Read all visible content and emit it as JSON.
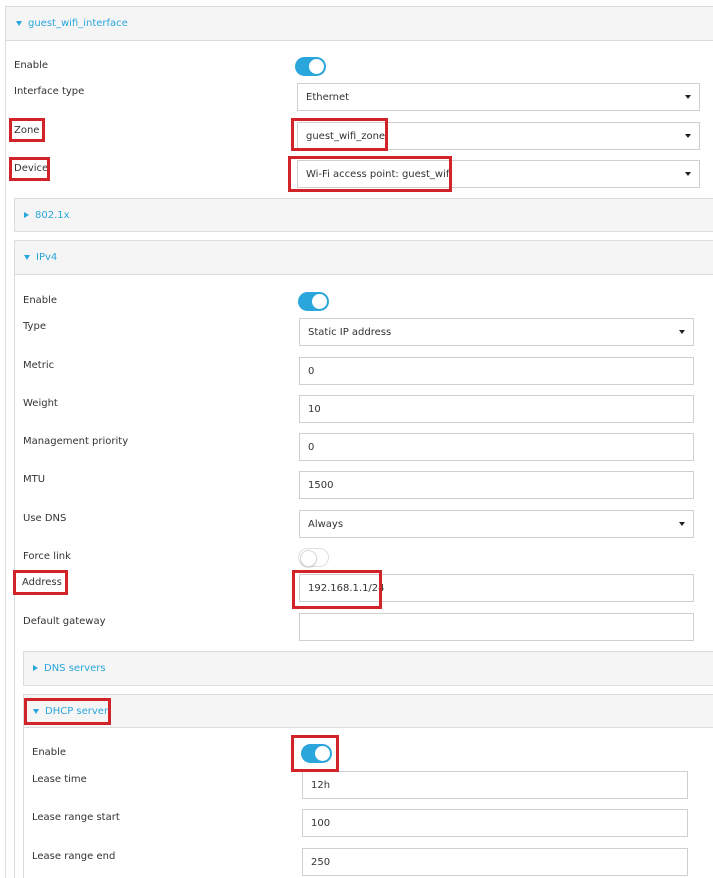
{
  "interface": {
    "title": "guest_wifi_interface",
    "enable_label": "Enable",
    "enabled": true,
    "interface_type_label": "Interface type",
    "interface_type_value": "Ethernet",
    "zone_label": "Zone",
    "zone_value": "guest_wifi_zone",
    "device_label": "Device",
    "device_value": "Wi-Fi access point: guest_wifi"
  },
  "dot1x": {
    "title": "802.1x"
  },
  "ipv4": {
    "title": "IPv4",
    "enable_label": "Enable",
    "enabled": true,
    "type_label": "Type",
    "type_value": "Static IP address",
    "metric_label": "Metric",
    "metric_value": "0",
    "weight_label": "Weight",
    "weight_value": "10",
    "mgmt_priority_label": "Management priority",
    "mgmt_priority_value": "0",
    "mtu_label": "MTU",
    "mtu_value": "1500",
    "use_dns_label": "Use DNS",
    "use_dns_value": "Always",
    "force_link_label": "Force link",
    "force_link": false,
    "address_label": "Address",
    "address_value": "192.168.1.1/24",
    "gateway_label": "Default gateway",
    "gateway_value": ""
  },
  "dns_servers": {
    "title": "DNS servers"
  },
  "dhcp": {
    "title": "DHCP server",
    "enable_label": "Enable",
    "enabled": true,
    "lease_time_label": "Lease time",
    "lease_time_value": "12h",
    "range_start_label": "Lease range start",
    "range_start_value": "100",
    "range_end_label": "Lease range end",
    "range_end_value": "250"
  },
  "colors": {
    "accent": "#2aa6dc",
    "highlight": "#d2232a",
    "header_bg": "#f5f5f5",
    "border": "#dcdcdc"
  }
}
